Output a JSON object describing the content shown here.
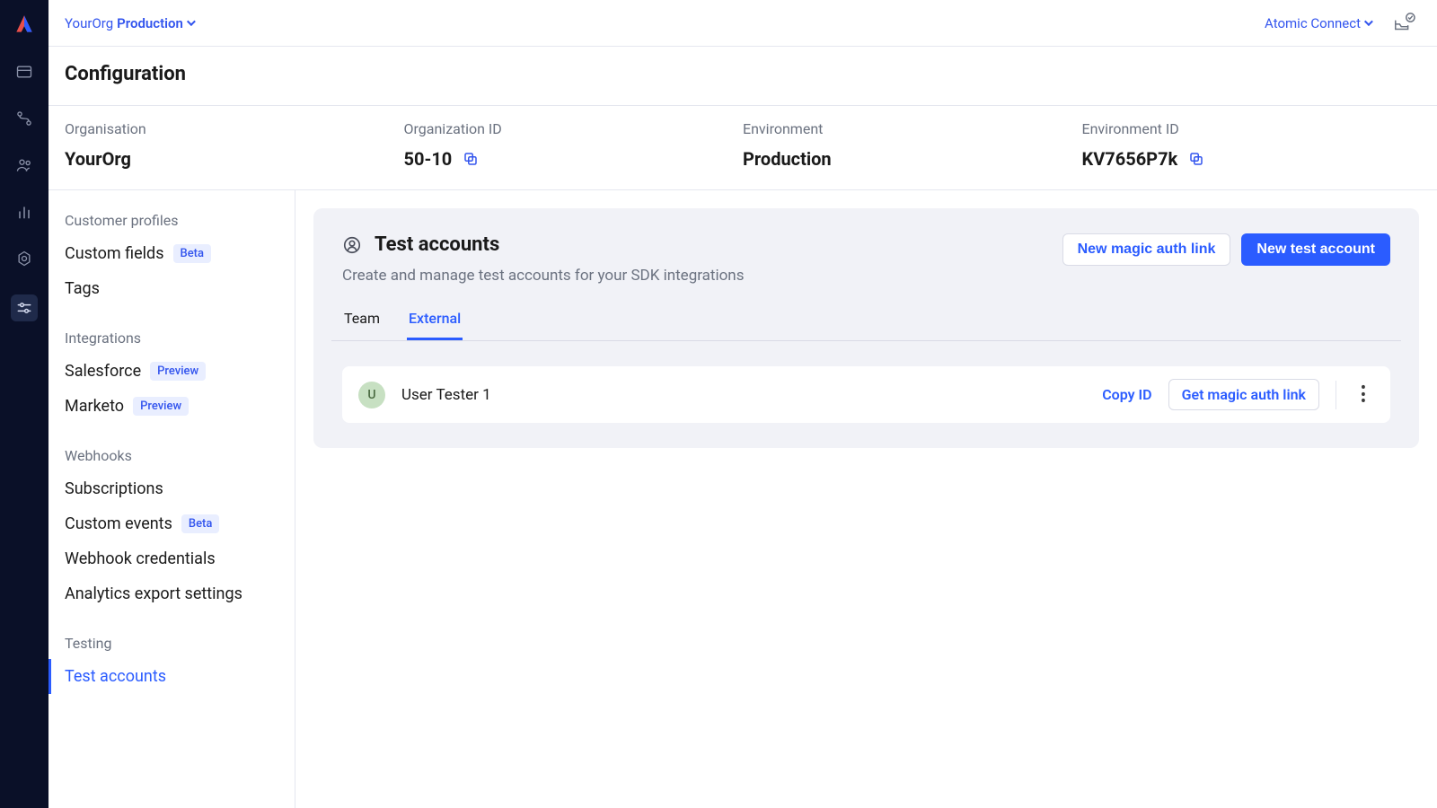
{
  "topbar": {
    "org": "YourOrg",
    "env": "Production",
    "right_link": "Atomic Connect"
  },
  "page_title": "Configuration",
  "meta": {
    "org_label": "Organisation",
    "org_value": "YourOrg",
    "org_id_label": "Organization ID",
    "org_id_value": "50-10",
    "env_label": "Environment",
    "env_value": "Production",
    "env_id_label": "Environment ID",
    "env_id_value": "KV7656P7k"
  },
  "sidebar": {
    "groups": [
      {
        "label": "Customer profiles",
        "items": [
          {
            "label": "Custom fields",
            "badge": "Beta"
          },
          {
            "label": "Tags"
          }
        ]
      },
      {
        "label": "Integrations",
        "items": [
          {
            "label": "Salesforce",
            "badge": "Preview"
          },
          {
            "label": "Marketo",
            "badge": "Preview"
          }
        ]
      },
      {
        "label": "Webhooks",
        "items": [
          {
            "label": "Subscriptions"
          },
          {
            "label": "Custom events",
            "badge": "Beta"
          },
          {
            "label": "Webhook credentials"
          },
          {
            "label": "Analytics export settings"
          }
        ]
      },
      {
        "label": "Testing",
        "items": [
          {
            "label": "Test accounts",
            "active": true
          }
        ]
      }
    ]
  },
  "panel": {
    "title": "Test accounts",
    "subtitle": "Create and manage test accounts for your SDK integrations",
    "action_secondary": "New magic auth link",
    "action_primary": "New test account",
    "tabs": [
      {
        "label": "Team"
      },
      {
        "label": "External",
        "active": true
      }
    ],
    "rows": [
      {
        "avatar_initial": "U",
        "name": "User Tester 1",
        "copy_label": "Copy ID",
        "auth_label": "Get magic auth link"
      }
    ]
  }
}
